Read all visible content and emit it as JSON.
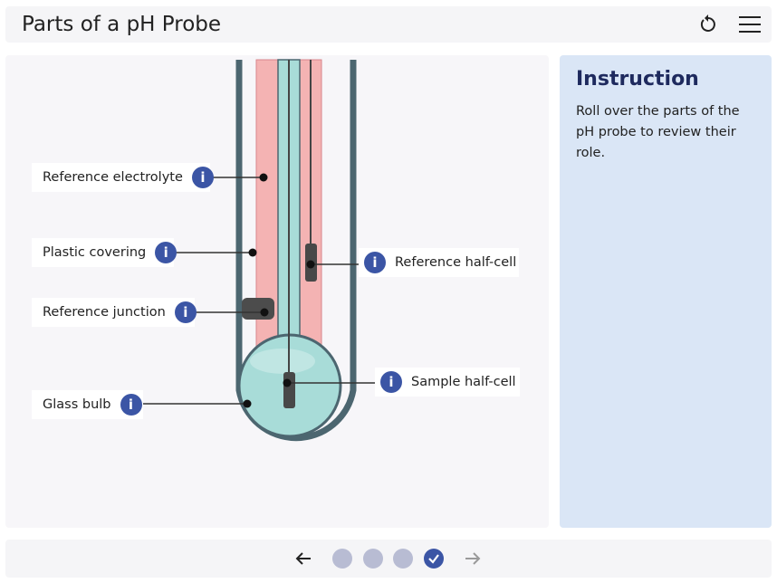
{
  "header": {
    "title": "Parts of a pH Probe",
    "reset_icon": "reset-icon",
    "menu_icon": "hamburger-menu-icon"
  },
  "probe": {
    "labels": {
      "reference_electrolyte": "Reference electrolyte",
      "plastic_covering": "Plastic covering",
      "reference_junction": "Reference junction",
      "glass_bulb": "Glass bulb",
      "reference_half_cell": "Reference half-cell",
      "sample_half_cell": "Sample half-cell"
    },
    "info_glyph": "i",
    "colors": {
      "outer_wall": "#4c6670",
      "electrolyte": "#f4b3b3",
      "glass": "#a8dcd8",
      "electrode": "#484848",
      "info": "#3b55a5"
    }
  },
  "instruction": {
    "title": "Instruction",
    "text": "Roll over the parts of the pH probe to review their role."
  },
  "footer": {
    "pages": [
      {
        "state": "pending"
      },
      {
        "state": "pending"
      },
      {
        "state": "pending"
      },
      {
        "state": "completed"
      }
    ],
    "prev_icon": "arrow-left-icon",
    "next_icon": "arrow-right-icon"
  }
}
